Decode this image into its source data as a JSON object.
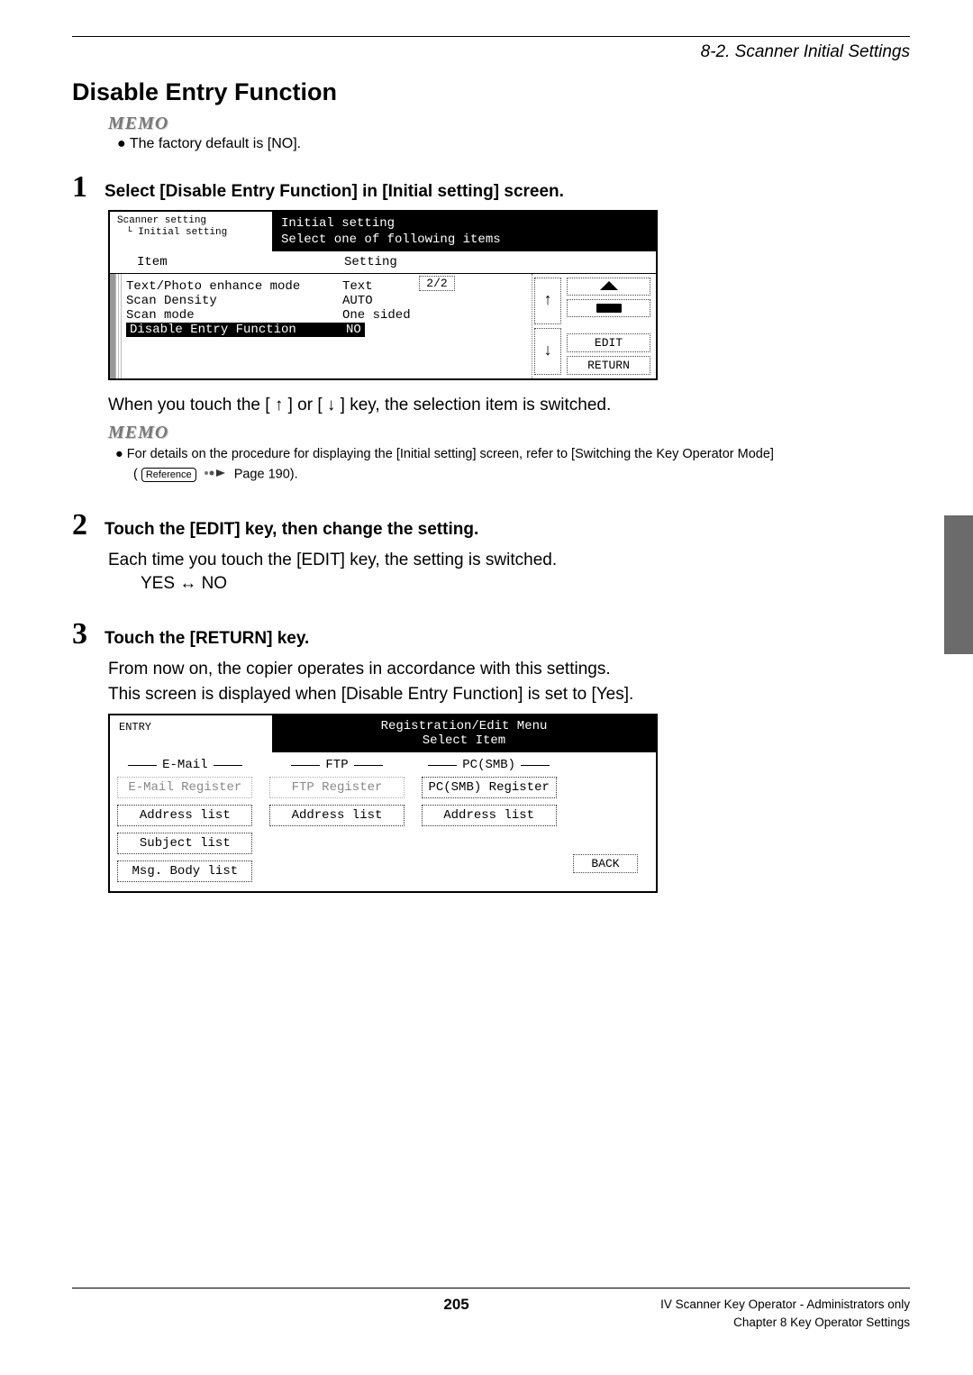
{
  "header": {
    "section_path": "8-2. Scanner Initial Settings"
  },
  "title": "Disable Entry Function",
  "memo_label": "MEMO",
  "memo1_bullet": "● The factory default is [NO].",
  "step1": {
    "num": "1",
    "title": "Select [Disable Entry Function] in [Initial setting] screen.",
    "caption": "When you touch the [ ↑ ] or [ ↓ ] key, the selection item is switched.",
    "memo_line1": "● For details on the procedure for displaying the [Initial setting] screen, refer to [Switching the Key Operator Mode]",
    "ref_label": "Reference",
    "memo_line2_tail": "Page 190)."
  },
  "shot1": {
    "breadcrumb1": "Scanner setting",
    "breadcrumb2": "Initial setting",
    "hdr_title": "Initial setting",
    "hdr_sub": "Select one of following items",
    "col_item": "Item",
    "col_setting": "Setting",
    "rows": [
      {
        "item": "Text/Photo enhance mode",
        "setting": "Text"
      },
      {
        "item": "Scan Density",
        "setting": "AUTO"
      },
      {
        "item": "Scan mode",
        "setting": "One sided"
      }
    ],
    "selected": {
      "item": "Disable Entry Function",
      "setting": "NO"
    },
    "page_frac": "2/2",
    "arrow_up": "↑",
    "arrow_down": "↓",
    "btn_edit": "EDIT",
    "btn_return": "RETURN"
  },
  "step2": {
    "num": "2",
    "title": "Touch the [EDIT] key, then change the setting.",
    "body": "Each time you touch the [EDIT] key, the setting is switched.",
    "toggle": "YES ↔ NO"
  },
  "step3": {
    "num": "3",
    "title": "Touch the [RETURN] key.",
    "body1": "From now on, the copier operates in accordance with this settings.",
    "body2": "This screen is displayed when [Disable Entry Function] is set to [Yes]."
  },
  "shot2": {
    "entry_label": "ENTRY",
    "hdr_title": "Registration/Edit Menu",
    "hdr_sub": "Select Item",
    "cols": {
      "email": {
        "label": "E-Mail",
        "btns": [
          "E-Mail Register",
          "Address list",
          "Subject list",
          "Msg. Body list"
        ],
        "dims": [
          true,
          false,
          false,
          false
        ]
      },
      "ftp": {
        "label": "FTP",
        "btns": [
          "FTP Register",
          "Address list"
        ],
        "dims": [
          true,
          false
        ]
      },
      "pcsmb": {
        "label": "PC(SMB)",
        "btns": [
          "PC(SMB) Register",
          "Address list"
        ],
        "dims": [
          false,
          false
        ]
      }
    },
    "btn_back": "BACK"
  },
  "footer": {
    "page_num": "205",
    "right1": "IV Scanner Key Operator - Administrators only",
    "right2": "Chapter 8 Key Operator Settings"
  }
}
